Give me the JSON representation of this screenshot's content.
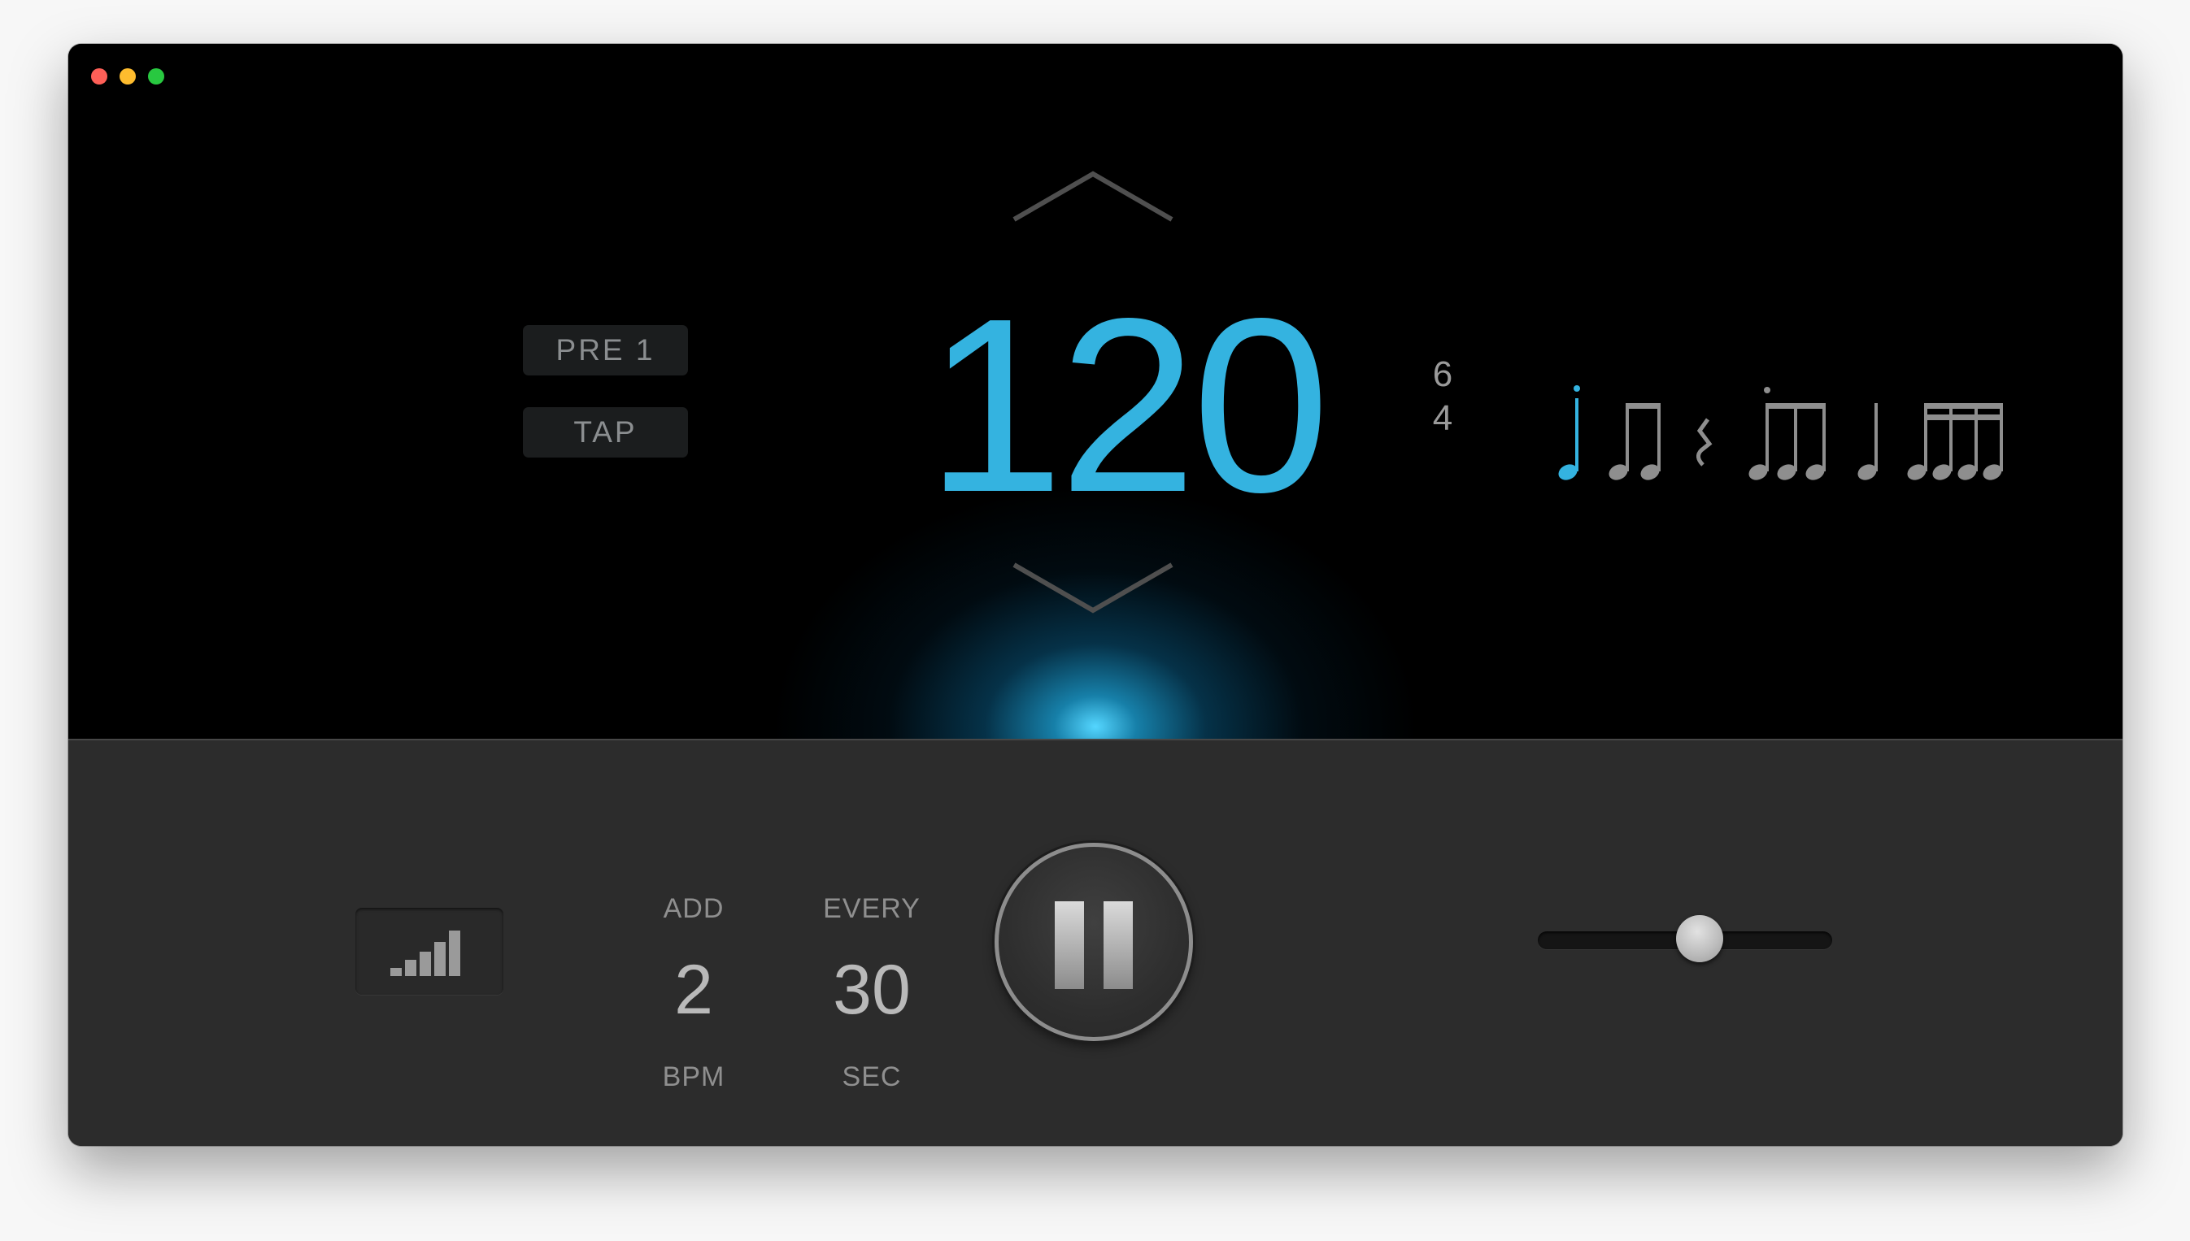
{
  "window": {
    "controls": [
      "close",
      "minimize",
      "zoom"
    ]
  },
  "display": {
    "preset_label": "PRE 1",
    "tap_label": "TAP",
    "tempo": "120",
    "time_signature": {
      "beats": "6",
      "unit": "4"
    },
    "rhythm_pattern": [
      "quarter-note-accent",
      "eighth-notes",
      "quarter-rest",
      "triplet-eighths",
      "quarter-note",
      "sixteenth-notes"
    ],
    "up_icon": "chevron-up-icon",
    "down_icon": "chevron-down-icon"
  },
  "trainer": {
    "add_label": "ADD",
    "add_value": "2",
    "add_unit": "BPM",
    "every_label": "EVERY",
    "every_value": "30",
    "every_unit": "SEC"
  },
  "transport": {
    "state_icon": "pause-icon",
    "volume_level": 0.55
  },
  "colors": {
    "accent": "#34b3e0",
    "background_top": "#000000",
    "background_bottom": "#2c2c2c"
  }
}
